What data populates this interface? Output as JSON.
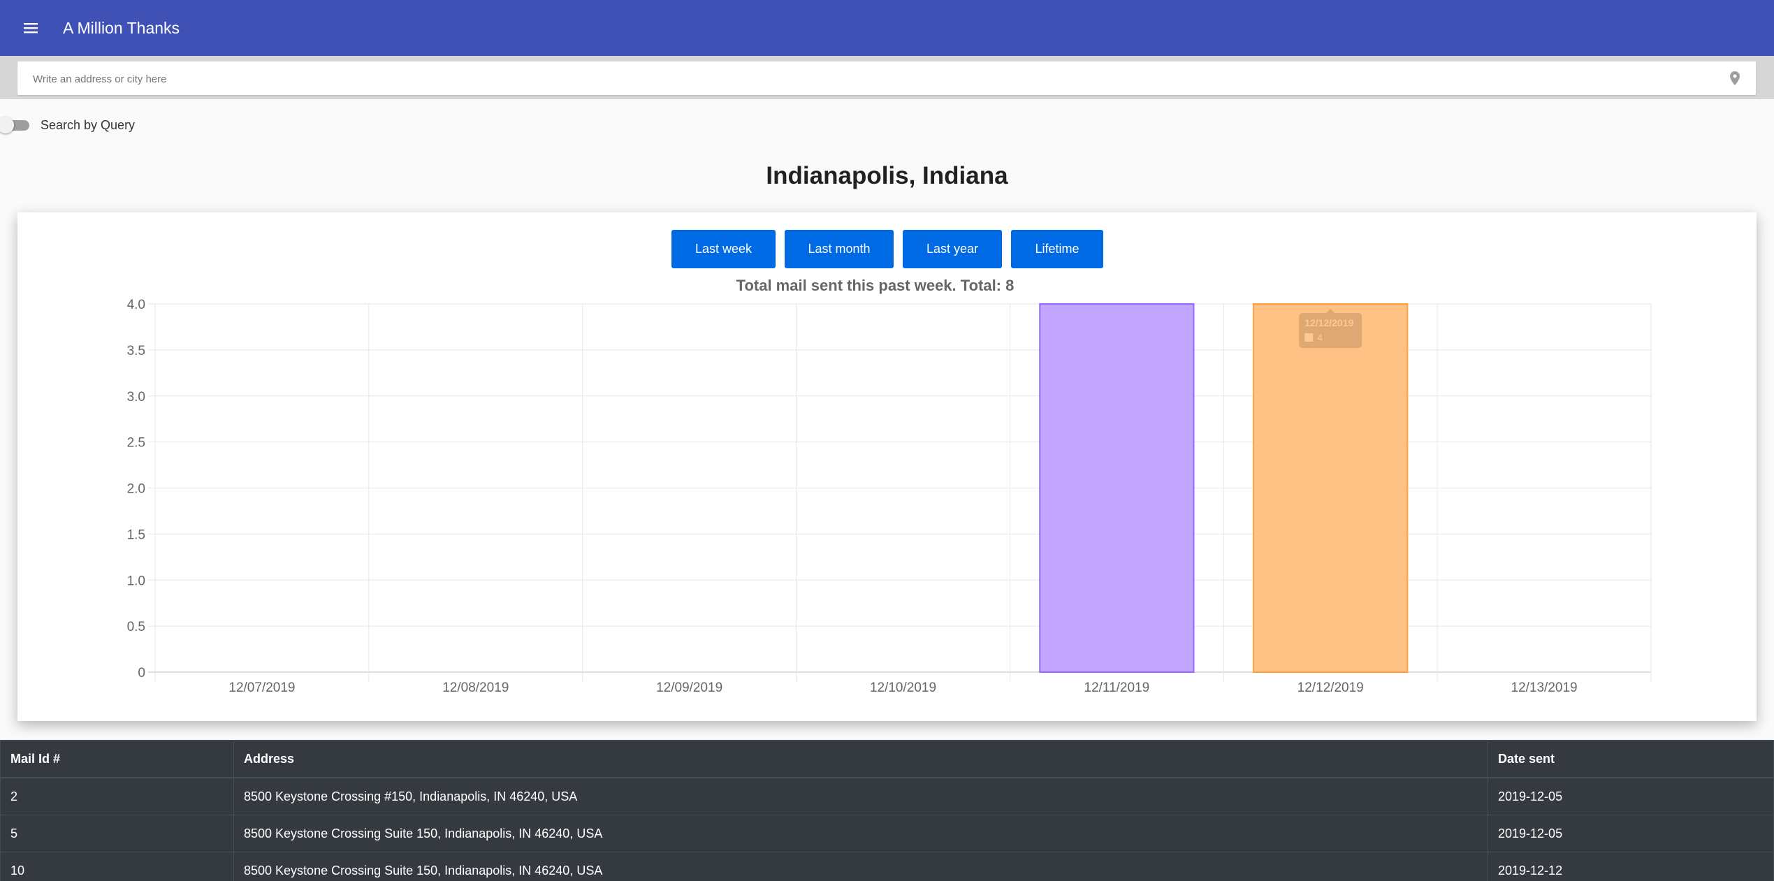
{
  "header": {
    "title": "A Million Thanks"
  },
  "search": {
    "placeholder": "Write an address or city here",
    "value": ""
  },
  "toggle": {
    "label": "Search by Query",
    "checked": false
  },
  "location": {
    "title": "Indianapolis, Indiana"
  },
  "range_buttons": [
    "Last week",
    "Last month",
    "Last year",
    "Lifetime"
  ],
  "chart_data": {
    "type": "bar",
    "title": "Total mail sent this past week. Total: 8",
    "categories": [
      "12/07/2019",
      "12/08/2019",
      "12/09/2019",
      "12/10/2019",
      "12/11/2019",
      "12/12/2019",
      "12/13/2019"
    ],
    "values": [
      0,
      0,
      0,
      0,
      4,
      4,
      0
    ],
    "colors": [
      null,
      null,
      null,
      null,
      "#c3a6ff",
      "#ffc184"
    ],
    "borders": [
      null,
      null,
      null,
      null,
      "#9966ff",
      "#ff9f40"
    ],
    "ylim": [
      0,
      4
    ],
    "yticks": [
      "0",
      "0.5",
      "1.0",
      "1.5",
      "2.0",
      "2.5",
      "3.0",
      "3.5",
      "4.0"
    ],
    "grid": true,
    "legend": "none",
    "tooltip": {
      "category": "12/12/2019",
      "value": 4,
      "visible": true
    }
  },
  "table": {
    "headers": [
      "Mail Id #",
      "Address",
      "Date sent"
    ],
    "rows": [
      [
        "2",
        "8500 Keystone Crossing #150, Indianapolis, IN 46240, USA",
        "2019-12-05"
      ],
      [
        "5",
        "8500 Keystone Crossing Suite 150, Indianapolis, IN 46240, USA",
        "2019-12-05"
      ],
      [
        "10",
        "8500 Keystone Crossing Suite 150, Indianapolis, IN 46240, USA",
        "2019-12-12"
      ]
    ]
  }
}
